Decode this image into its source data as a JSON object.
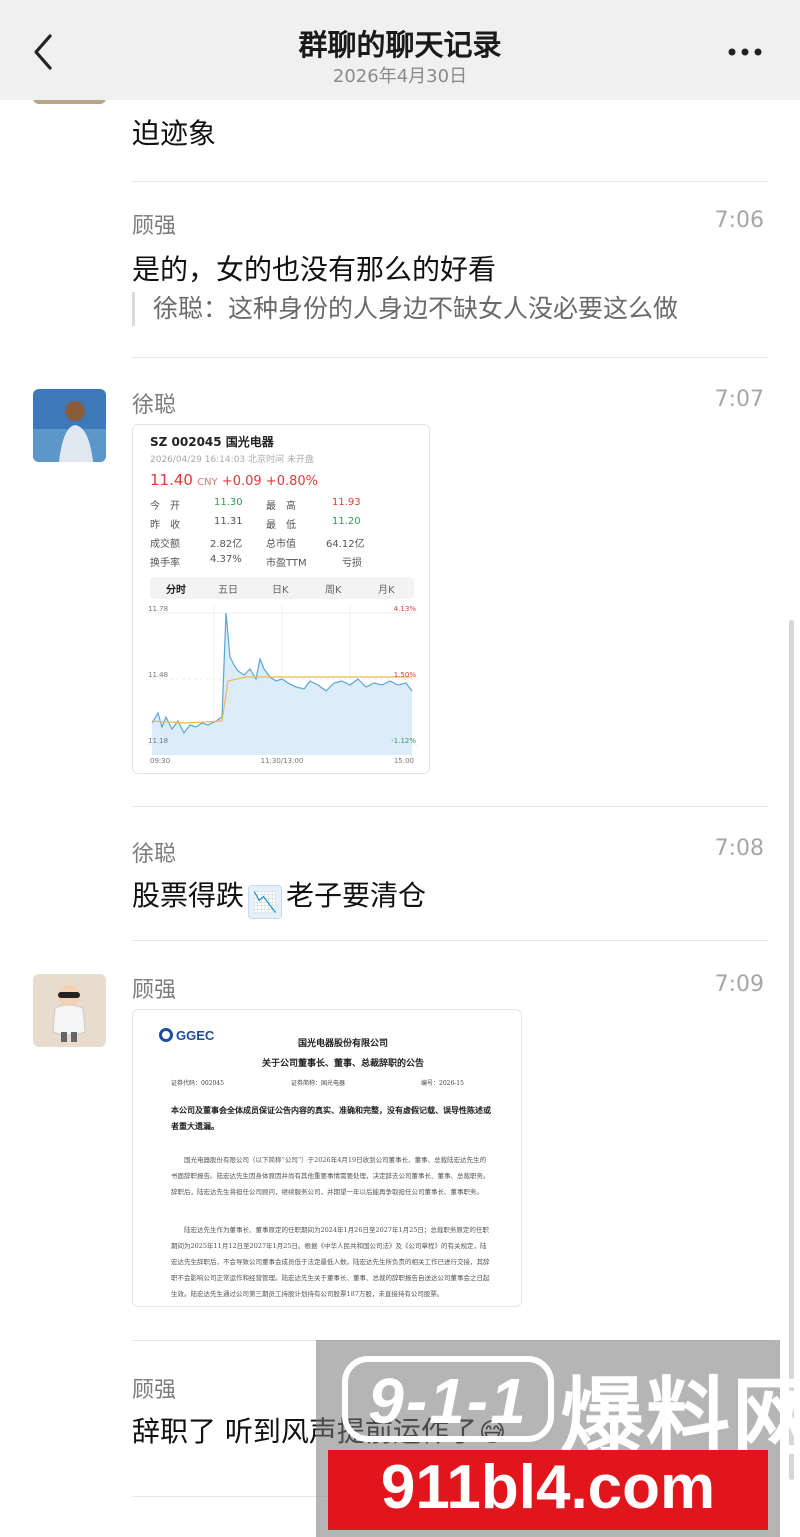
{
  "header": {
    "title": "群聊的聊天记录",
    "date": "2026年4月30日"
  },
  "messages": [
    {
      "text": "迫迹象"
    },
    {
      "sender": "顾强",
      "time": "7:06",
      "text": "是的，女的也没有那么的好看",
      "quote": "徐聪：这种身份的人身边不缺女人没必要这么做"
    },
    {
      "sender": "徐聪",
      "time": "7:07",
      "type": "image-stock"
    },
    {
      "sender": "徐聪",
      "time": "7:08",
      "text_before": "股票得跌",
      "emoji": "📉",
      "text_after": "老子要清仓"
    },
    {
      "sender": "顾强",
      "time": "7:09",
      "type": "image-document"
    },
    {
      "sender": "顾强",
      "text": "辞职了 听到风声提前运作了",
      "emoji": "😅"
    }
  ],
  "stock": {
    "code": "SZ 002045  国光电器",
    "datetime": "2026/04/29 16:14:03 北京时间 未开盘",
    "price": "11.40",
    "currency": "CNY",
    "change": "+0.09",
    "change_pct": "+0.80%",
    "rows": [
      {
        "l1": "今　开",
        "v1": "11.30",
        "l2": "最　高",
        "v2": "11.93"
      },
      {
        "l1": "昨　收",
        "v1": "11.31",
        "l2": "最　低",
        "v2": "11.20"
      },
      {
        "l1": "成交额",
        "v1": "2.82亿",
        "l2": "总市值",
        "v2": "64.12亿"
      },
      {
        "l1": "换手率",
        "v1": "4.37%",
        "l2": "市盈TTM",
        "v2": "亏损"
      }
    ],
    "tabs": [
      "分时",
      "五日",
      "日K",
      "周K",
      "月K"
    ],
    "active_tab": "分时",
    "chart": {
      "y_top": "11.78",
      "y_mid": "11.48",
      "y_bot": "11.18",
      "pct_top": "4.13%",
      "pct_mid": "1.50%",
      "pct_bot": "-1.12%",
      "x_start": "09:30",
      "x_mid": "11:30/13:00",
      "x_end": "15:00",
      "line_color": "#5aa6d8",
      "avg_color": "#f0b94a"
    }
  },
  "document": {
    "logo": "GGEC",
    "company": "国光电器股份有限公司",
    "title": "关于公司董事长、董事、总裁辞职的公告",
    "code_label": "证券代码：002045",
    "short_label": "证券简称：国光电器",
    "number_label": "编号：2026-15",
    "statement": "本公司及董事会全体成员保证公告内容的真实、准确和完整，没有虚假记载、误导性陈述或者重大遗漏。",
    "para1": "国光电器股份有限公司（以下简称“公司”）于2026年4月19日收到公司董事长、董事、总裁陆宏达先生的书面辞职报告。陆宏达先生因身体原因并尚有其他重要事情需要处理，决定辞去公司董事长、董事、总裁职务。辞职后，陆宏达先生将担任公司顾问，继续服务公司，并期望一年以后能再争取担任公司董事长、董事职务。",
    "para2": "陆宏达先生作为董事长、董事原定的任职期间为2024年1月26日至2027年1月25日；总裁职务原定的任职期间为2025年11月12日至2027年1月25日。根据《中华人民共和国公司法》及《公司章程》的有关规定，陆宏达先生辞职后，不会导致公司董事会成员低于法定最低人数。陆宏达先生所负责的相关工作已进行交接，其辞职不会影响公司正常运作和经营管理。陆宏达先生关于董事长、董事、总裁的辞职报告自送达公司董事会之日起生效。陆宏达先生通过公司第三期员工持股计划持有公司股票187万股，未直接持有公司股票。"
  },
  "watermark": {
    "badge": "9-1-1",
    "cn": "爆料网",
    "url": "911bl4.com"
  }
}
